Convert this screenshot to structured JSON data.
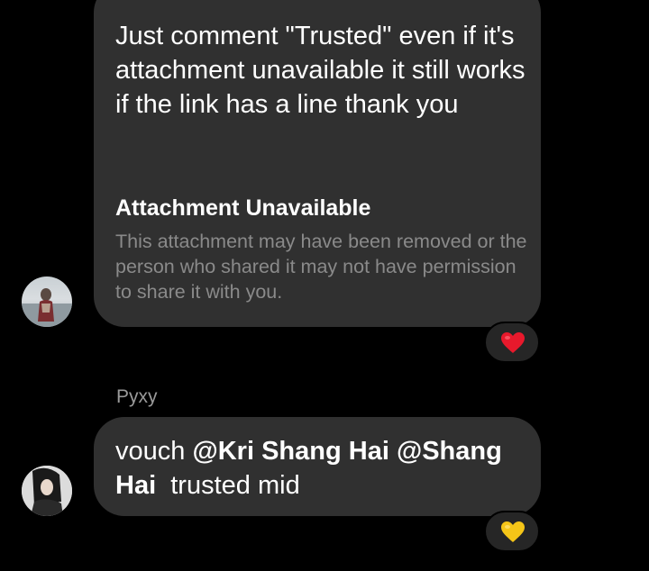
{
  "message1": {
    "text": "Just comment \"Trusted\" even if it's attachment unavailable it still works if the link has a line thank you",
    "attachment_title": "Attachment Unavailable",
    "attachment_description": "This attachment may have been removed or the person who shared it may not have permission to share it with you.",
    "reaction": "red-heart-icon",
    "reaction_color": "#e8192c"
  },
  "message2": {
    "sender": "Pyxy",
    "prefix": "vouch ",
    "mention1": "@Kri Shang Hai",
    "mention2": "@Shang Hai",
    "suffix": "  trusted mid",
    "reaction": "yellow-heart-icon",
    "reaction_color": "#f5c518"
  },
  "colors": {
    "background": "#000000",
    "bubble": "#303030",
    "secondary_text": "#8a8a8a"
  }
}
